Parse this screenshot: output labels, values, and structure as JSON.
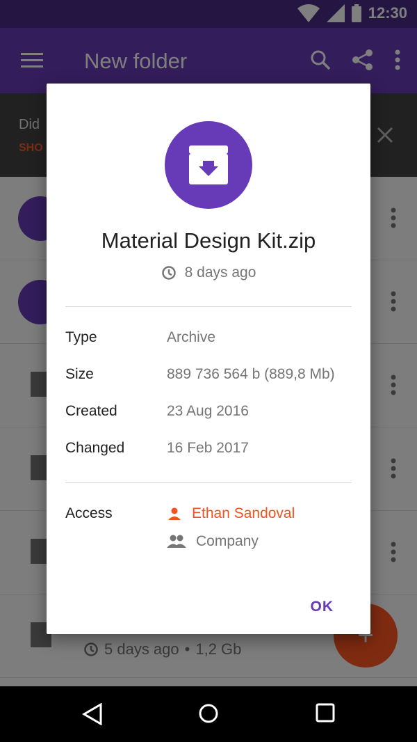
{
  "status_bar": {
    "time": "12:30"
  },
  "app_bar": {
    "title": "New folder"
  },
  "banner": {
    "line1": "Did",
    "line2": "SHO"
  },
  "list": {
    "last_row_subtitle": "5 days ago",
    "last_row_size": "1,2 Gb"
  },
  "dialog": {
    "file_name": "Material Design Kit.zip",
    "modified_ago": "8 days ago",
    "details": [
      {
        "label": "Type",
        "value": "Archive"
      },
      {
        "label": "Size",
        "value": "889 736 564 b (889,8 Mb)"
      },
      {
        "label": "Created",
        "value": "23 Aug 2016"
      },
      {
        "label": "Changed",
        "value": "16 Feb 2017"
      }
    ],
    "access_label": "Access",
    "access": [
      {
        "name": "Ethan Sandoval",
        "icon": "person-icon",
        "color": "#f4511e"
      },
      {
        "name": "Company",
        "icon": "group-icon",
        "color": "#757575"
      }
    ],
    "ok_label": "OK"
  },
  "colors": {
    "primary": "#673ab7",
    "primary_dark": "#4a2a86",
    "accent": "#ff5722"
  }
}
